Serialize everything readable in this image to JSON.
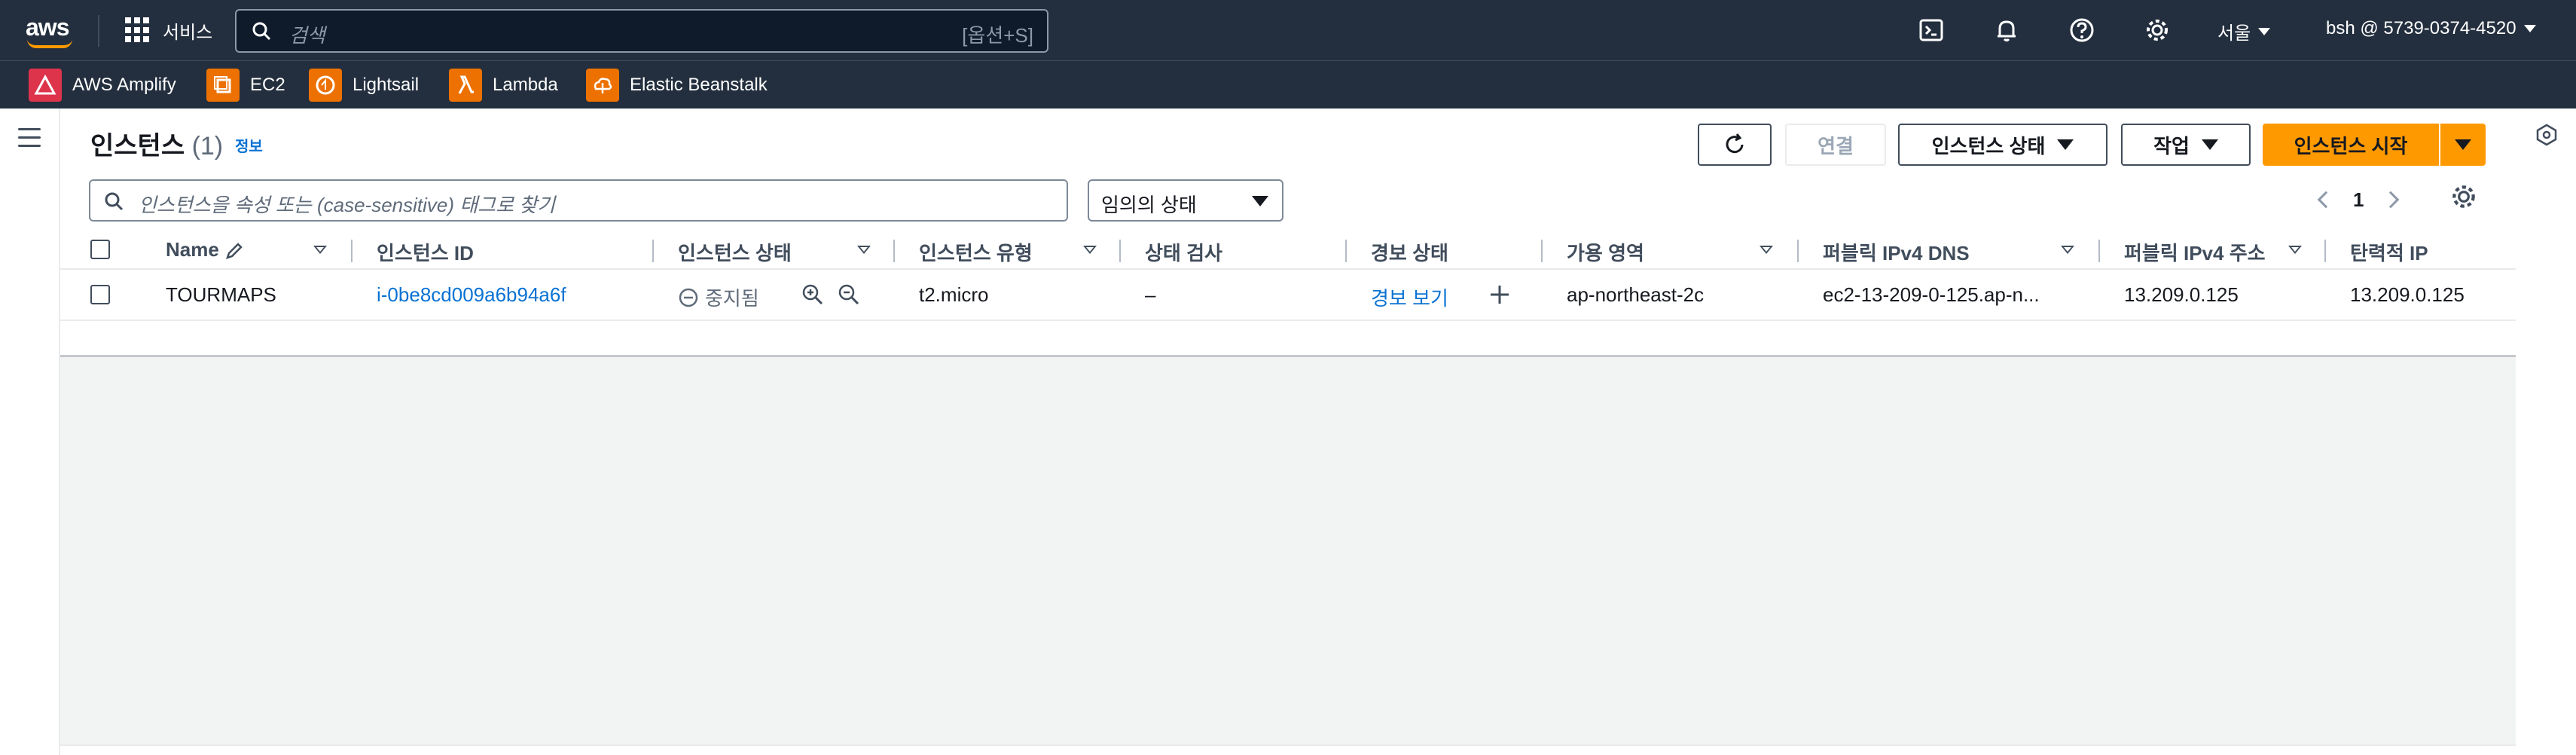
{
  "topnav": {
    "logo": "aws",
    "services_label": "서비스",
    "search_placeholder": "검색",
    "search_shortcut": "[옵션+S]",
    "region": "서울",
    "account": "bsh @ 5739-0374-4520",
    "icons": [
      "cloudshell-icon",
      "bell-icon",
      "help-icon",
      "settings-icon"
    ]
  },
  "favorites": [
    {
      "label": "AWS Amplify",
      "color": "#dd344c"
    },
    {
      "label": "EC2",
      "color": "#ed7100"
    },
    {
      "label": "Lightsail",
      "color": "#ed7100"
    },
    {
      "label": "Lambda",
      "color": "#ed7100"
    },
    {
      "label": "Elastic Beanstalk",
      "color": "#ed7100"
    }
  ],
  "header": {
    "title": "인스턴스",
    "count": "(1)",
    "info": "정보",
    "buttons": {
      "connect": "연결",
      "instance_state": "인스턴스 상태",
      "actions": "작업",
      "launch": "인스턴스 시작"
    }
  },
  "filter": {
    "placeholder": "인스턴스을 속성 또는 (case-sensitive) 태그로 찾기",
    "state_select": "임의의 상태"
  },
  "pagination": {
    "page": "1"
  },
  "table": {
    "columns": [
      "Name",
      "인스턴스 ID",
      "인스턴스 상태",
      "인스턴스 유형",
      "상태 검사",
      "경보 상태",
      "가용 영역",
      "퍼블릭 IPv4 DNS",
      "퍼블릭 IPv4 주소",
      "탄력적 IP"
    ],
    "rows": [
      {
        "name": "TOURMAPS",
        "instance_id": "i-0be8cd009a6b94a6f",
        "state": "중지됨",
        "type": "t2.micro",
        "status_check": "–",
        "alarm": "경보 보기",
        "az": "ap-northeast-2c",
        "dns": "ec2-13-209-0-125.ap-n...",
        "ipv4": "13.209.0.125",
        "eip": "13.209.0.125"
      }
    ]
  },
  "colors": {
    "nav_bg": "#232f3e",
    "primary": "#ff9900",
    "link": "#0972d3"
  }
}
